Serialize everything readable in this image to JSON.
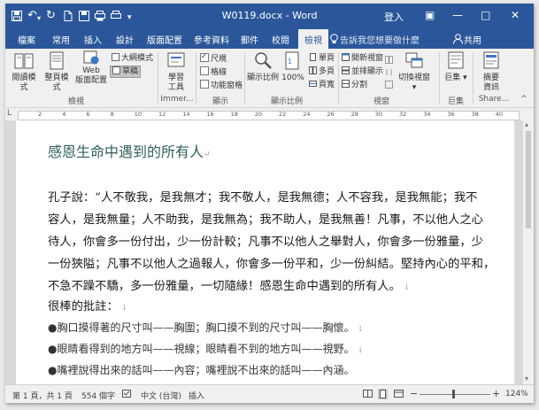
{
  "titlebar": {
    "undo": "↶",
    "redo": "↻",
    "customize": "▾",
    "document_title": "W0119.docx  -  Word",
    "login": "登入",
    "minimize": "—",
    "maximize": "□",
    "close": "✕",
    "ribbon_display": "▣"
  },
  "tabs": [
    {
      "label": "檔案"
    },
    {
      "label": "常用"
    },
    {
      "label": "插入"
    },
    {
      "label": "設計"
    },
    {
      "label": "版面配置"
    },
    {
      "label": "參考資料"
    },
    {
      "label": "郵件"
    },
    {
      "label": "校閱"
    },
    {
      "label": "檢視"
    }
  ],
  "tellme": "告訴我您想要做什麼",
  "share": "共用",
  "ribbon": {
    "views": {
      "read_mode": "閱讀模式",
      "print_layout": "整頁模式",
      "web_layout_1": "Web",
      "web_layout_2": "版面配置",
      "outline": "大綱模式",
      "draft": "草稿",
      "label": "檢視"
    },
    "immersive": {
      "learning_tools_1": "學習",
      "learning_tools_2": "工具",
      "label": "Immer..."
    },
    "show": {
      "ruler": "尺規",
      "gridlines": "格線",
      "nav_pane": "功能窗格",
      "label": "顯示"
    },
    "zoom": {
      "zoom": "顯示比例",
      "hundred": "100%",
      "one_page": "單頁",
      "multi_page": "多頁",
      "page_width": "頁寬",
      "label": "顯示比例"
    },
    "window": {
      "new_window": "開新視窗",
      "arrange_all": "並排顯示",
      "split": "分割",
      "switch_windows": "切換視窗",
      "label": "視窗"
    },
    "macros": {
      "macros": "巨集",
      "label": "巨集"
    },
    "sharepoint": {
      "properties_1": "摘要",
      "properties_2": "資訊",
      "label": "Share..."
    }
  },
  "ruler": {
    "tick_labels": [
      "2",
      "4",
      "6",
      "8",
      "10",
      "12",
      "14",
      "16",
      "18",
      "20",
      "22",
      "24",
      "26",
      "28",
      "30",
      "32",
      "34",
      "36",
      "38",
      "40"
    ]
  },
  "document": {
    "heading": "感恩生命中遇到的所有人",
    "paragraph_lines": [
      "孔子說：“人不敬我，是我無才；我不敬人，是我無德；人不容我，是我無能；我不",
      "容人，是我無量；人不助我，是我無為；我不助人，是我無善！凡事，不以他人之心",
      "待人，你會多一份付出，少一份計較；凡事不以他人之舉對人，你會多一份雅量，少",
      "一份狹隘；凡事不以他人之過報人，你會多一份平和，少一份糾結。堅持內心的平和，",
      "不急不躁不驕，多一份雅量，一切隨緣！感恩生命中遇到的所有人。"
    ],
    "comment_title": "很棒的批註：",
    "bullets": [
      "●胸口摸得著的尺寸叫——胸圍；胸口摸不到的尺寸叫——胸懷。",
      "●眼睛看得到的地方叫——視線；眼睛看不到的地方叫——視野。",
      "●嘴裡說得出來的話叫——內容；嘴裡說不出來的話叫——內涵。"
    ]
  },
  "status": {
    "page": "第 1 頁，共 1 頁",
    "words": "554 個字",
    "language": "中文 (台灣)",
    "mode": "插入",
    "zoom_level": "124%",
    "zoom_minus": "−",
    "zoom_plus": "+"
  },
  "colors": {
    "accent": "#2b579a",
    "heading": "#2f5f5a"
  }
}
